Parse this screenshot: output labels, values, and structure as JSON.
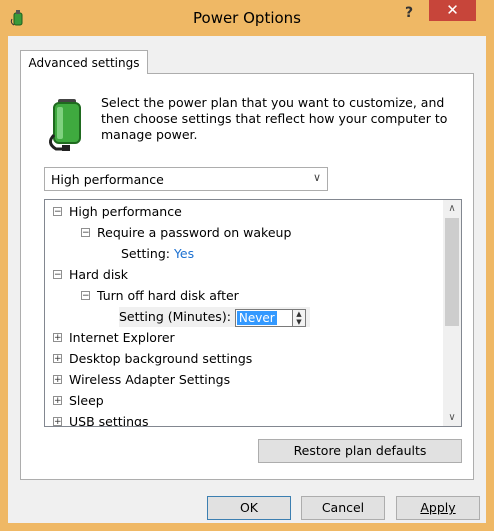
{
  "window": {
    "title": "Power Options",
    "help_label": "?",
    "close_label": "✕"
  },
  "tab": {
    "label": "Advanced settings"
  },
  "description": "Select the power plan that you want to customize, and then choose settings that reflect how your computer to manage power.",
  "plan_select": {
    "value": "High performance"
  },
  "tree": {
    "items": [
      {
        "label": "High performance",
        "expander": "−"
      },
      {
        "label": "Require a password on wakeup",
        "expander": "−"
      },
      {
        "label": "Setting:",
        "value": "Yes"
      },
      {
        "label": "Hard disk",
        "expander": "−"
      },
      {
        "label": "Turn off hard disk after",
        "expander": "−"
      },
      {
        "label": "Setting (Minutes):",
        "value": "Never"
      },
      {
        "label": "Internet Explorer",
        "expander": "+"
      },
      {
        "label": "Desktop background settings",
        "expander": "+"
      },
      {
        "label": "Wireless Adapter Settings",
        "expander": "+"
      },
      {
        "label": "Sleep",
        "expander": "+"
      },
      {
        "label": "USB settings",
        "expander": "+"
      }
    ]
  },
  "buttons": {
    "restore": "Restore plan defaults",
    "ok": "OK",
    "cancel": "Cancel",
    "apply": "Apply"
  },
  "colors": {
    "titlebar": "#efb865",
    "close": "#c7453a",
    "setting_value": "#1a6fd0",
    "selection": "#3399ff"
  }
}
